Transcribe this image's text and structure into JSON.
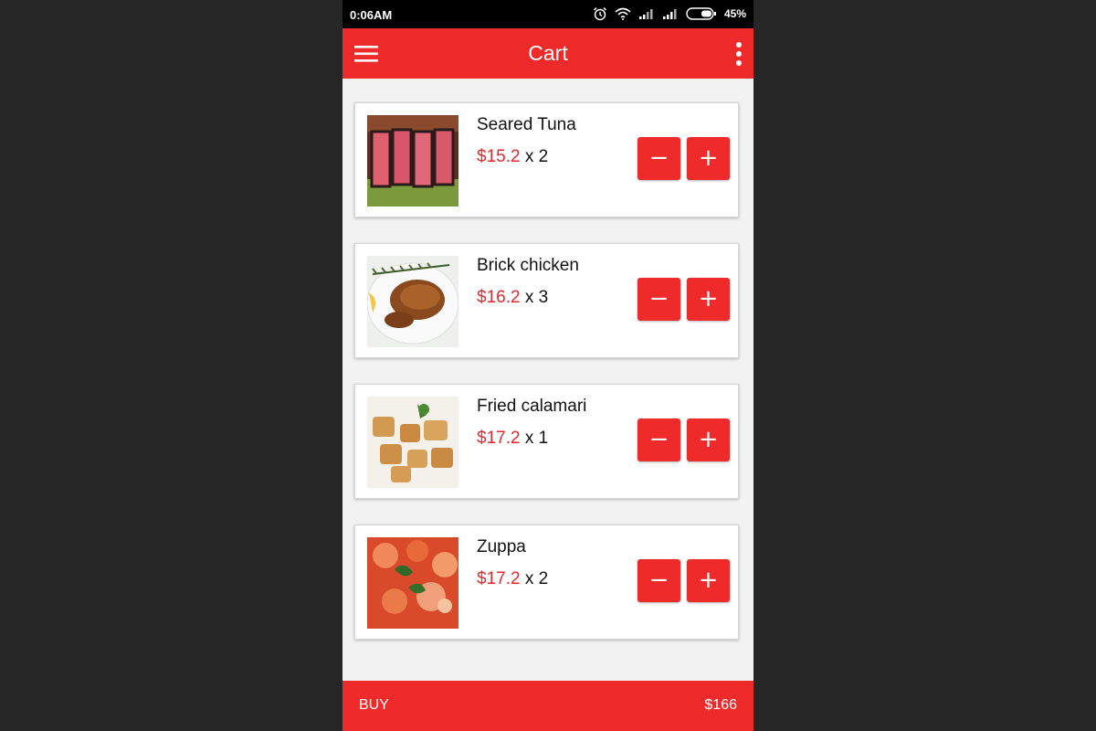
{
  "status_bar": {
    "time": "0:06AM",
    "battery": "45%"
  },
  "app_bar": {
    "title": "Cart"
  },
  "cart": {
    "items": [
      {
        "name": "Seared Tuna",
        "price": "$15.2",
        "qty": "x 2",
        "image": "seared-tuna-image"
      },
      {
        "name": "Brick chicken",
        "price": "$16.2",
        "qty": "x 3",
        "image": "brick-chicken-image"
      },
      {
        "name": "Fried calamari",
        "price": "$17.2",
        "qty": "x 1",
        "image": "fried-calamari-image"
      },
      {
        "name": "Zuppa",
        "price": "$17.2",
        "qty": "x 2",
        "image": "zuppa-image"
      }
    ],
    "minus_label": "−",
    "plus_label": "+"
  },
  "bottom_bar": {
    "buy_label": "BUY",
    "total": "$166"
  },
  "colors": {
    "accent": "#ee2a2a",
    "price": "#e8282c",
    "background": "#f2f2f2"
  },
  "icons": [
    "alarm-icon",
    "wifi-icon",
    "signal-icon",
    "battery-icon",
    "menu-icon",
    "more-vert-icon"
  ]
}
